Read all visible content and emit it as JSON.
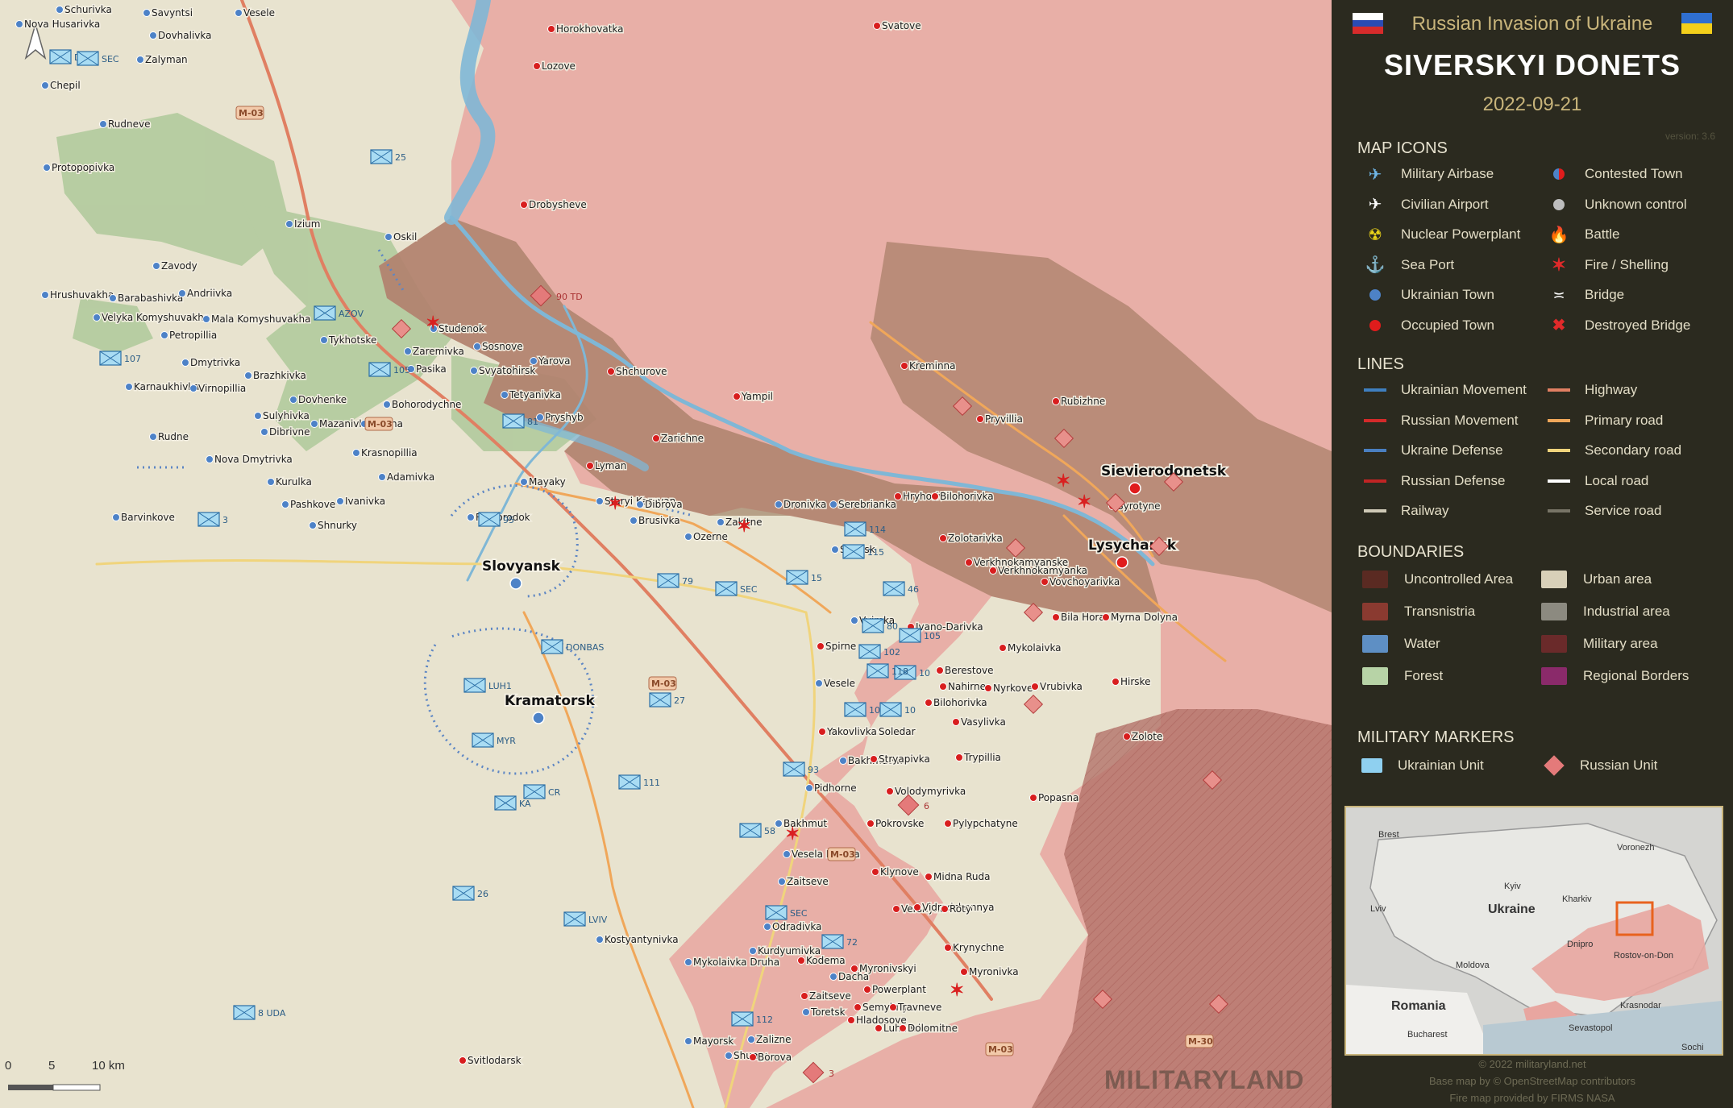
{
  "header": {
    "subtitle": "Russian Invasion of Ukraine",
    "title": "SIVERSKYI DONETS",
    "date": "2022-09-21",
    "version": "version: 3.6"
  },
  "legend": {
    "map_icons": {
      "heading": "MAP ICONS",
      "left": [
        {
          "label": "Military Airbase",
          "icon": "military-airbase-icon"
        },
        {
          "label": "Civilian Airport",
          "icon": "civilian-airport-icon"
        },
        {
          "label": "Nuclear Powerplant",
          "icon": "nuclear-icon"
        },
        {
          "label": "Sea Port",
          "icon": "anchor-icon"
        },
        {
          "label": "Ukrainian Town",
          "icon": "blue-dot-icon"
        },
        {
          "label": "Occupied Town",
          "icon": "red-dot-icon"
        }
      ],
      "right": [
        {
          "label": "Contested Town",
          "icon": "half-dot-icon"
        },
        {
          "label": "Unknown control",
          "icon": "grey-dot-icon"
        },
        {
          "label": "Battle",
          "icon": "fire-icon"
        },
        {
          "label": "Fire / Shelling",
          "icon": "shelling-icon"
        },
        {
          "label": "Bridge",
          "icon": "bridge-icon"
        },
        {
          "label": "Destroyed Bridge",
          "icon": "destroyed-bridge-icon"
        }
      ]
    },
    "lines": {
      "heading": "LINES",
      "left": [
        {
          "label": "Ukrainian Movement",
          "color": "#3f7fbf"
        },
        {
          "label": "Russian Movement",
          "color": "#d42a2a"
        },
        {
          "label": "Ukraine Defense",
          "color": "#4a7fc0"
        },
        {
          "label": "Russian Defense",
          "color": "#c02424"
        },
        {
          "label": "Railway",
          "color": "#cfc9b6"
        }
      ],
      "right": [
        {
          "label": "Highway",
          "color": "#e07f62"
        },
        {
          "label": "Primary road",
          "color": "#f0a75a"
        },
        {
          "label": "Secondary road",
          "color": "#f0d47c"
        },
        {
          "label": "Local road",
          "color": "#ffffff"
        },
        {
          "label": "Service road",
          "color": "#777466"
        }
      ]
    },
    "boundaries": {
      "heading": "BOUNDARIES",
      "left": [
        {
          "label": "Uncontrolled Area",
          "color": "#5a2a22"
        },
        {
          "label": "Transnistria",
          "color": "#8a3a30"
        },
        {
          "label": "Water",
          "color": "#5e8fc4"
        },
        {
          "label": "Forest",
          "color": "#b7d3a6"
        }
      ],
      "right": [
        {
          "label": "Urban area",
          "color": "#d8d0b8"
        },
        {
          "label": "Industrial area",
          "color": "#8c8a80"
        },
        {
          "label": "Military area",
          "color": "#6a2a2a"
        },
        {
          "label": "Regional Borders",
          "color": "#8a2a6a"
        }
      ]
    },
    "military_markers": {
      "heading": "MILITARY MARKERS",
      "items": [
        {
          "label": "Ukrainian Unit",
          "color": "#8fd0f0"
        },
        {
          "label": "Russian Unit",
          "color": "#e47a7a"
        }
      ]
    }
  },
  "inset": {
    "labels": [
      "Brest",
      "Voronezh",
      "Kyiv",
      "Kharkiv",
      "Lviv",
      "Ukraine",
      "Dnipro",
      "Rostov-on-Don",
      "Moldova",
      "Romania",
      "Krasnodar",
      "Sevastopol",
      "Bucharest",
      "Sochi"
    ]
  },
  "credits": {
    "line1": "© 2022 militaryland.net",
    "line2": "Base map by © OpenStreetMap contributors",
    "line3": "Fire map provided by FIRMS NASA"
  },
  "map": {
    "towns_major": [
      {
        "name": "Slovyansk",
        "ctrl": "ua"
      },
      {
        "name": "Kramatorsk",
        "ctrl": "ua"
      },
      {
        "name": "Sievierodonetsk",
        "ctrl": "ru"
      },
      {
        "name": "Lysychansk",
        "ctrl": "ru"
      }
    ],
    "towns": [
      {
        "name": "Schurivka",
        "ctrl": "ua"
      },
      {
        "name": "Savyntsi",
        "ctrl": "ua"
      },
      {
        "name": "Vesele",
        "ctrl": "ua"
      },
      {
        "name": "Nova Husarivka",
        "ctrl": "ua"
      },
      {
        "name": "Dovhalivka",
        "ctrl": "ua"
      },
      {
        "name": "Zalyman",
        "ctrl": "ua"
      },
      {
        "name": "Chepil",
        "ctrl": "ua"
      },
      {
        "name": "Rudneve",
        "ctrl": "ua"
      },
      {
        "name": "Protopopivka",
        "ctrl": "ua"
      },
      {
        "name": "Izium",
        "ctrl": "ua"
      },
      {
        "name": "Oskil",
        "ctrl": "ua"
      },
      {
        "name": "Zavody",
        "ctrl": "ua"
      },
      {
        "name": "Hrushuvakha",
        "ctrl": "ua"
      },
      {
        "name": "Barabashivka",
        "ctrl": "ua"
      },
      {
        "name": "Andriivka",
        "ctrl": "ua"
      },
      {
        "name": "Velyka Komyshuvakha",
        "ctrl": "ua"
      },
      {
        "name": "Mala Komyshuvakha",
        "ctrl": "ua"
      },
      {
        "name": "Petropillia",
        "ctrl": "ua"
      },
      {
        "name": "Tykhotske",
        "ctrl": "ua"
      },
      {
        "name": "Studenok",
        "ctrl": "ua"
      },
      {
        "name": "Sosnove",
        "ctrl": "ua"
      },
      {
        "name": "Yarova",
        "ctrl": "ua"
      },
      {
        "name": "Zaremivka",
        "ctrl": "ua"
      },
      {
        "name": "Pasika",
        "ctrl": "ua"
      },
      {
        "name": "Svyatohirsk",
        "ctrl": "ua"
      },
      {
        "name": "Dmytrivka",
        "ctrl": "ua"
      },
      {
        "name": "Karnaukhivka",
        "ctrl": "ua"
      },
      {
        "name": "Virnopillia",
        "ctrl": "ua"
      },
      {
        "name": "Brazhkivka",
        "ctrl": "ua"
      },
      {
        "name": "Tetyanivka",
        "ctrl": "ua"
      },
      {
        "name": "Bohorodychne",
        "ctrl": "ua"
      },
      {
        "name": "Dovhenke",
        "ctrl": "ua"
      },
      {
        "name": "Sulyhivka",
        "ctrl": "ua"
      },
      {
        "name": "Mazanivka",
        "ctrl": "ua"
      },
      {
        "name": "Dolyna",
        "ctrl": "ua"
      },
      {
        "name": "Pryshyb",
        "ctrl": "ua"
      },
      {
        "name": "Dibrivne",
        "ctrl": "ua"
      },
      {
        "name": "Krasnopillia",
        "ctrl": "ua"
      },
      {
        "name": "Rudne",
        "ctrl": "ua"
      },
      {
        "name": "Nova Dmytrivka",
        "ctrl": "ua"
      },
      {
        "name": "Adamivka",
        "ctrl": "ua"
      },
      {
        "name": "Kurulka",
        "ctrl": "ua"
      },
      {
        "name": "Mayaky",
        "ctrl": "ua"
      },
      {
        "name": "Pashkove",
        "ctrl": "ua"
      },
      {
        "name": "Ivanivka",
        "ctrl": "ua"
      },
      {
        "name": "Shnurky",
        "ctrl": "ua"
      },
      {
        "name": "Barvinkove",
        "ctrl": "ua"
      },
      {
        "name": "Raihorodok",
        "ctrl": "ua"
      },
      {
        "name": "Staryi Karavan",
        "ctrl": "ua"
      },
      {
        "name": "Dibrova",
        "ctrl": "ua"
      },
      {
        "name": "Brusivka",
        "ctrl": "ua"
      },
      {
        "name": "Ozerne",
        "ctrl": "ua"
      },
      {
        "name": "Zakitne",
        "ctrl": "ua"
      },
      {
        "name": "Dronivka",
        "ctrl": "ua"
      },
      {
        "name": "Serebrianka",
        "ctrl": "ua"
      },
      {
        "name": "Siversk",
        "ctrl": "ua"
      },
      {
        "name": "Vyimka",
        "ctrl": "ua"
      },
      {
        "name": "Ivano-Darivka",
        "ctrl": "ru"
      },
      {
        "name": "Spirne",
        "ctrl": "ru"
      },
      {
        "name": "Vesele",
        "ctrl": "ua"
      },
      {
        "name": "Soledar",
        "ctrl": "ua"
      },
      {
        "name": "Yakovlivka",
        "ctrl": "ru"
      },
      {
        "name": "Bakhmutske",
        "ctrl": "ua"
      },
      {
        "name": "Pidhorne",
        "ctrl": "ua"
      },
      {
        "name": "Bakhmut",
        "ctrl": "ua"
      },
      {
        "name": "Vesela Dolyna",
        "ctrl": "ua"
      },
      {
        "name": "Zaitseve",
        "ctrl": "ua"
      },
      {
        "name": "Kostyantynivka",
        "ctrl": "ua"
      },
      {
        "name": "Odradivka",
        "ctrl": "ua"
      },
      {
        "name": "Kurdyumivka",
        "ctrl": "ua"
      },
      {
        "name": "Mykolaivka Druha",
        "ctrl": "ua"
      },
      {
        "name": "Kodema",
        "ctrl": "ru"
      },
      {
        "name": "Dacha",
        "ctrl": "ua"
      },
      {
        "name": "Zaitseve",
        "ctrl": "ru"
      },
      {
        "name": "Toretsk",
        "ctrl": "ua"
      },
      {
        "name": "Mayorsk",
        "ctrl": "ua"
      },
      {
        "name": "Zalizne",
        "ctrl": "ua"
      },
      {
        "name": "Shumy",
        "ctrl": "ua"
      },
      {
        "name": "Borova",
        "ctrl": "ru"
      },
      {
        "name": "Horokhovatka",
        "ctrl": "ru"
      },
      {
        "name": "Lozove",
        "ctrl": "ru"
      },
      {
        "name": "Drobysheve",
        "ctrl": "ru"
      },
      {
        "name": "Shchurove",
        "ctrl": "ru"
      },
      {
        "name": "Lyman",
        "ctrl": "ru"
      },
      {
        "name": "Zarichne",
        "ctrl": "ru"
      },
      {
        "name": "Yampil",
        "ctrl": "ru"
      },
      {
        "name": "Svatove",
        "ctrl": "ru"
      },
      {
        "name": "Kreminna",
        "ctrl": "ru"
      },
      {
        "name": "Rubizhne",
        "ctrl": "ru"
      },
      {
        "name": "Pryvillia",
        "ctrl": "ru"
      },
      {
        "name": "Hryhorivka",
        "ctrl": "ru"
      },
      {
        "name": "Bilohorivka",
        "ctrl": "ru"
      },
      {
        "name": "Syrotyne",
        "ctrl": "ru"
      },
      {
        "name": "Zolotarivka",
        "ctrl": "ru"
      },
      {
        "name": "Verkhnokamyanske",
        "ctrl": "ru"
      },
      {
        "name": "Verkhnokamyanka",
        "ctrl": "ru"
      },
      {
        "name": "Vovchoyarivka",
        "ctrl": "ru"
      },
      {
        "name": "Bila Hora",
        "ctrl": "ru"
      },
      {
        "name": "Myrna Dolyna",
        "ctrl": "ru"
      },
      {
        "name": "Mykolaivka",
        "ctrl": "ru"
      },
      {
        "name": "Berestove",
        "ctrl": "ru"
      },
      {
        "name": "Nahirne",
        "ctrl": "ru"
      },
      {
        "name": "Nyrkove",
        "ctrl": "ru"
      },
      {
        "name": "Vrubivka",
        "ctrl": "ru"
      },
      {
        "name": "Hirske",
        "ctrl": "ru"
      },
      {
        "name": "Bilohorivka",
        "ctrl": "ru"
      },
      {
        "name": "Vasylivka",
        "ctrl": "ru"
      },
      {
        "name": "Zolote",
        "ctrl": "ru"
      },
      {
        "name": "Trypillia",
        "ctrl": "ru"
      },
      {
        "name": "Stryapivka",
        "ctrl": "ru"
      },
      {
        "name": "Volodymyrivka",
        "ctrl": "ru"
      },
      {
        "name": "Popasna",
        "ctrl": "ru"
      },
      {
        "name": "Pokrovske",
        "ctrl": "ru"
      },
      {
        "name": "Pylypchatyne",
        "ctrl": "ru"
      },
      {
        "name": "Klynove",
        "ctrl": "ru"
      },
      {
        "name": "Midna Ruda",
        "ctrl": "ru"
      },
      {
        "name": "Vershyna",
        "ctrl": "ru"
      },
      {
        "name": "Vidrodzhennya",
        "ctrl": "ru"
      },
      {
        "name": "Roty",
        "ctrl": "ru"
      },
      {
        "name": "Krynychne",
        "ctrl": "ru"
      },
      {
        "name": "Myronivka",
        "ctrl": "ru"
      },
      {
        "name": "Myronivskyi",
        "ctrl": "ru"
      },
      {
        "name": "Powerplant",
        "ctrl": "ru"
      },
      {
        "name": "Semyhirya",
        "ctrl": "ru"
      },
      {
        "name": "Hladosove",
        "ctrl": "ru"
      },
      {
        "name": "Travneve",
        "ctrl": "ru"
      },
      {
        "name": "Luhanske",
        "ctrl": "ru"
      },
      {
        "name": "Dolomitne",
        "ctrl": "ru"
      },
      {
        "name": "Svitlodarsk",
        "ctrl": "ru"
      }
    ],
    "roads": [
      "M-03",
      "M-03",
      "M-03",
      "M-03",
      "M-03",
      "M-30"
    ],
    "units_ua": [
      "25",
      "107",
      "105",
      "81",
      "95",
      "3",
      "79",
      "SEC",
      "15",
      "114",
      "115",
      "46",
      "80",
      "105",
      "102",
      "10",
      "118",
      "108",
      "10",
      "93",
      "111",
      "KA",
      "CR",
      "58",
      "72",
      "SEC",
      "LVIV",
      "26",
      "112",
      "DP",
      "SEC",
      "AZOV",
      "DONBAS",
      "LUH1",
      "MYR",
      "27",
      "8 UDA"
    ],
    "units_ru": [
      "90 TD",
      "6",
      "3"
    ],
    "scale": {
      "labels": [
        "0",
        "5",
        "10 km"
      ]
    },
    "watermark": "MILITARYLAND"
  }
}
